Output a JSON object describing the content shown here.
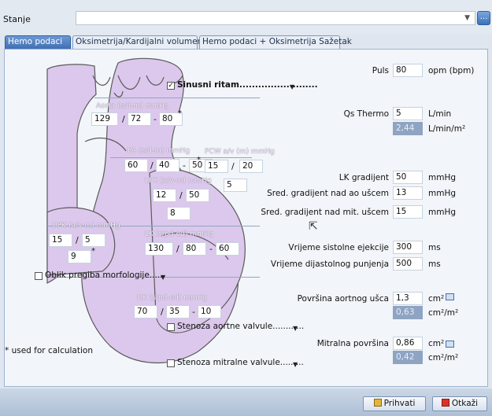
{
  "header": {
    "stanje_label": "Stanje",
    "stanje_value": "",
    "stanje_button": "..."
  },
  "tabs": [
    {
      "label": "Hemo podaci",
      "active": true
    },
    {
      "label": "Oksimetrija/Kardijalni volumen",
      "active": false
    },
    {
      "label": "Hemo podaci + Oksimetrija Sažetak",
      "active": false
    }
  ],
  "heart": {
    "sinusni_ritam": {
      "label": "Sinusni ritam.........................",
      "checked": true
    },
    "aorta": {
      "label": "Aorta (s/d-m) mmHg",
      "s": "129",
      "d": "72",
      "m": "80",
      "note": "*"
    },
    "pa": {
      "label": "PA (s/d-m) mmHg",
      "s": "60",
      "d": "40",
      "m": "50",
      "note": "*"
    },
    "pcw": {
      "label": "PCW a/v (m) mmHg",
      "a": "15",
      "v": "20",
      "m": "5"
    },
    "lpk": {
      "label": "LPK (a/v-m) mmHg",
      "a": "12",
      "v": "50",
      "m": "8"
    },
    "dpk": {
      "label": "DPK (a/v-m) mmHg",
      "a": "15",
      "v": "5",
      "m": "9",
      "note": "*"
    },
    "lk": {
      "label": "LK (s/pd-ed) mmHg",
      "s": "130",
      "pd": "80",
      "ed": "60"
    },
    "oblik": {
      "label": "Oblik pregiba morfologije......",
      "checked": false
    },
    "dk": {
      "label": "DK (s/pd-ed) mmHg",
      "s": "70",
      "pd": "35",
      "ed": "10"
    },
    "stenoza_aortne": {
      "label": "Stenoza aortne valvule............",
      "checked": false
    },
    "stenoza_mitralne": {
      "label": "Stenoza mitralne valvule.........",
      "checked": false
    },
    "footnote": "* used for calculation"
  },
  "fields": {
    "puls": {
      "label": "Puls",
      "value": "80",
      "unit": "opm (bpm)"
    },
    "qs_thermo": {
      "label": "Qs Thermo",
      "value": "5",
      "unit": "L/min",
      "ro_value": "2,44",
      "ro_unit": "L/min/m²"
    },
    "lk_gradijent": {
      "label": "LK gradijent",
      "value": "50",
      "unit": "mmHg"
    },
    "sred_ao": {
      "label": "Sred. gradijent nad ao ušcem",
      "value": "13",
      "unit": "mmHg"
    },
    "sred_mit": {
      "label": "Sred. gradijent nad mit. ušcem",
      "value": "15",
      "unit": "mmHg"
    },
    "sistolne": {
      "label": "Vrijeme sistolne ejekcije",
      "value": "300",
      "unit": "ms"
    },
    "dijastolnog": {
      "label": "Vrijeme dijastolnog punjenja",
      "value": "500",
      "unit": "ms"
    },
    "aortnog": {
      "label": "Površina aortnog ušca",
      "value": "1,3",
      "unit": "cm²",
      "ro_value": "0,63",
      "ro_unit": "cm²/m²"
    },
    "mitralna": {
      "label": "Mitralna površina",
      "value": "0,86",
      "unit": "cm²",
      "ro_value": "0,42",
      "ro_unit": "cm²/m²"
    }
  },
  "buttons": {
    "accept": "Prihvati",
    "cancel": "Otkaži"
  },
  "colors": {
    "heart_fill": "#dcc8ec",
    "heart_stroke": "#5a5a5a",
    "tab_active": "#3e6fb4",
    "readonly": "#8ea4c2"
  }
}
